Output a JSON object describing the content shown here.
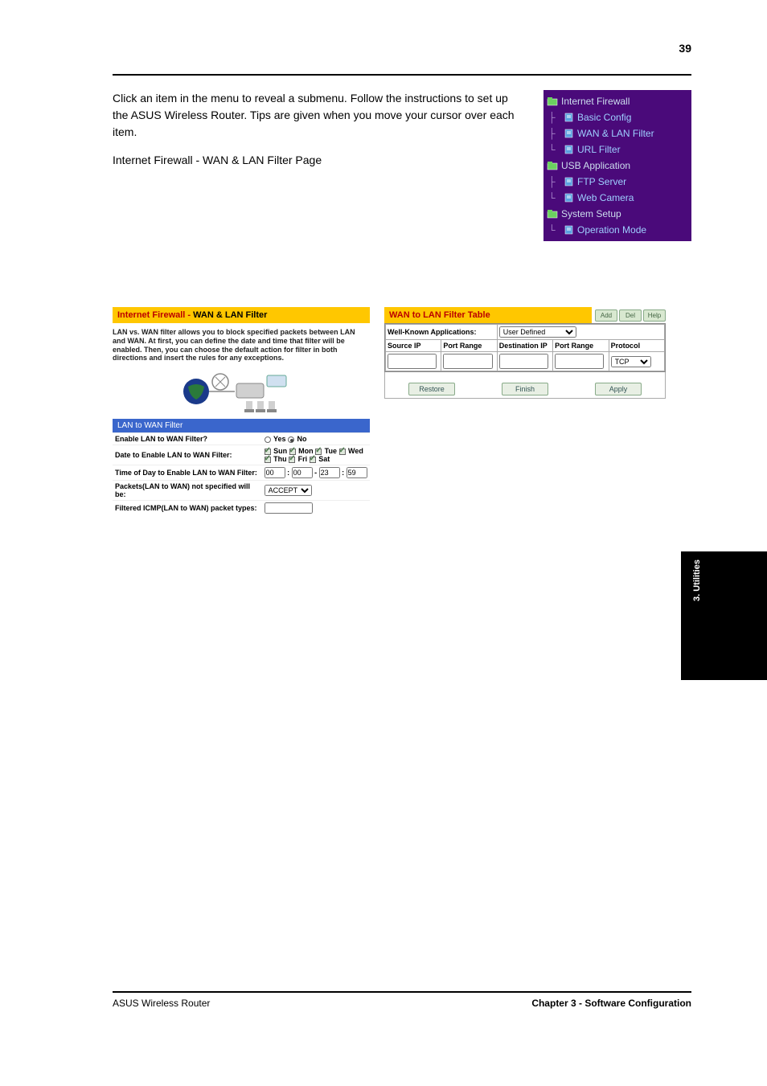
{
  "page_number": "39",
  "intro_para1": "Click an item in the menu to reveal a submenu. Follow the instructions to set up the ASUS Wireless Router. Tips are given when you move your cursor over each item.",
  "intro_para2": "Internet Firewall - WAN & LAN Filter Page",
  "nav": {
    "items": [
      {
        "label": "Internet Firewall",
        "type": "parent"
      },
      {
        "label": "Basic Config",
        "type": "child"
      },
      {
        "label": "WAN & LAN Filter",
        "type": "child"
      },
      {
        "label": "URL Filter",
        "type": "child"
      },
      {
        "label": "USB Application",
        "type": "parent"
      },
      {
        "label": "FTP Server",
        "type": "child"
      },
      {
        "label": "Web Camera",
        "type": "child"
      },
      {
        "label": "System Setup",
        "type": "parent"
      },
      {
        "label": "Operation Mode",
        "type": "child"
      }
    ]
  },
  "left_panel": {
    "header_red": "Internet Firewall - ",
    "header_black": "WAN & LAN Filter",
    "desc": "LAN vs. WAN filter allows you to block specified packets between LAN and WAN. At first, you can define the date and time that filter will be enabled. Then, you can choose the default action for filter in both directions and insert the rules for any exceptions.",
    "section_header": "LAN to WAN Filter",
    "row_enable": "Enable LAN to WAN Filter?",
    "opt_yes": "Yes",
    "opt_no": "No",
    "row_date": "Date to Enable LAN to WAN Filter:",
    "days": [
      "Sun",
      "Mon",
      "Tue",
      "Wed",
      "Thu",
      "Fri",
      "Sat"
    ],
    "row_time": "Time of Day to Enable LAN to WAN Filter:",
    "time_vals": [
      "00",
      "00",
      "23",
      "59"
    ],
    "row_packets": "Packets(LAN to WAN) not specified will be:",
    "packets_select": "ACCEPT",
    "row_icmp": "Filtered ICMP(LAN to WAN) packet types:"
  },
  "right_panel": {
    "header": "WAN to LAN Filter Table",
    "btn_add": "Add",
    "btn_del": "Del",
    "btn_help": "Help",
    "row_wellknown": "Well-Known Applications:",
    "wellknown_value": "User Defined",
    "cols": [
      "Source IP",
      "Port Range",
      "Destination IP",
      "Port Range",
      "Protocol"
    ],
    "proto_value": "TCP",
    "btn_restore": "Restore",
    "btn_finish": "Finish",
    "btn_apply": "Apply"
  },
  "footer": {
    "left": "ASUS Wireless Router",
    "right": "Chapter 3 - Software Configuration"
  },
  "sidebar_label": "3. Utilities"
}
